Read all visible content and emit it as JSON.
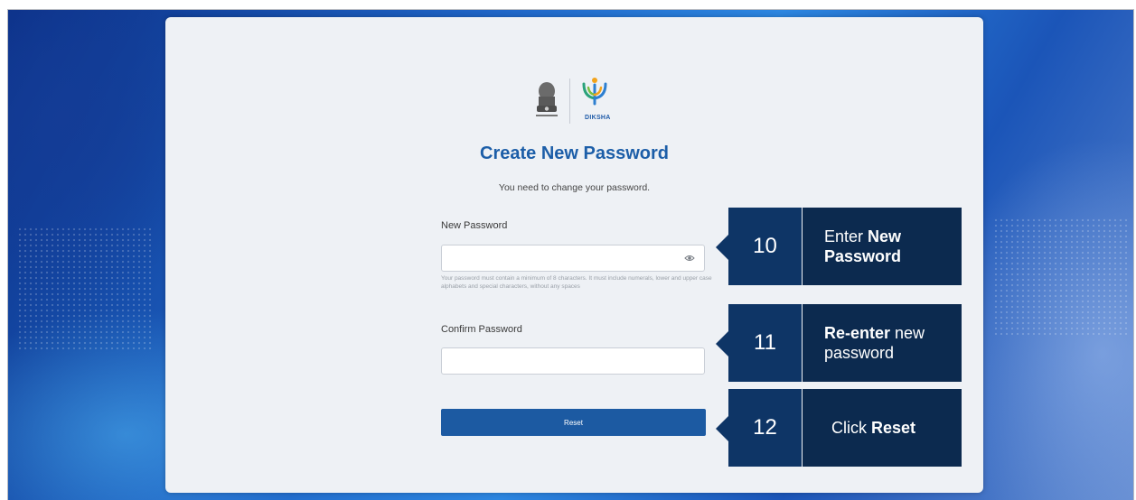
{
  "card": {
    "brand_text": "DIKSHA",
    "title": "Create New Password",
    "subtitle": "You need to change your password."
  },
  "form": {
    "new_password_label": "New Password",
    "new_password_value": "",
    "password_hint": "Your password must contain a minimum of 8 characters. It must include numerals, lower and upper case alphabets and special characters, without any spaces",
    "confirm_password_label": "Confirm Password",
    "confirm_password_value": "",
    "reset_label": "Reset"
  },
  "callouts": [
    {
      "number": "10",
      "line1_plain": "Enter ",
      "line1_bold": "New",
      "line2_bold": "Password",
      "line2_plain": ""
    },
    {
      "number": "11",
      "line1_plain": " new",
      "line1_bold": "Re-enter",
      "line2_bold": "",
      "line2_plain": "password"
    },
    {
      "number": "12",
      "line1_plain": "Click ",
      "line1_bold": "Reset",
      "line2_bold": "",
      "line2_plain": ""
    }
  ],
  "colors": {
    "accent": "#1c5aa2",
    "title": "#1c5ea8",
    "callout_dark": "#0c2a4f",
    "callout_num": "#0e3566"
  },
  "icons": [
    "national-emblem-icon",
    "diksha-logo-icon",
    "eye-icon"
  ]
}
